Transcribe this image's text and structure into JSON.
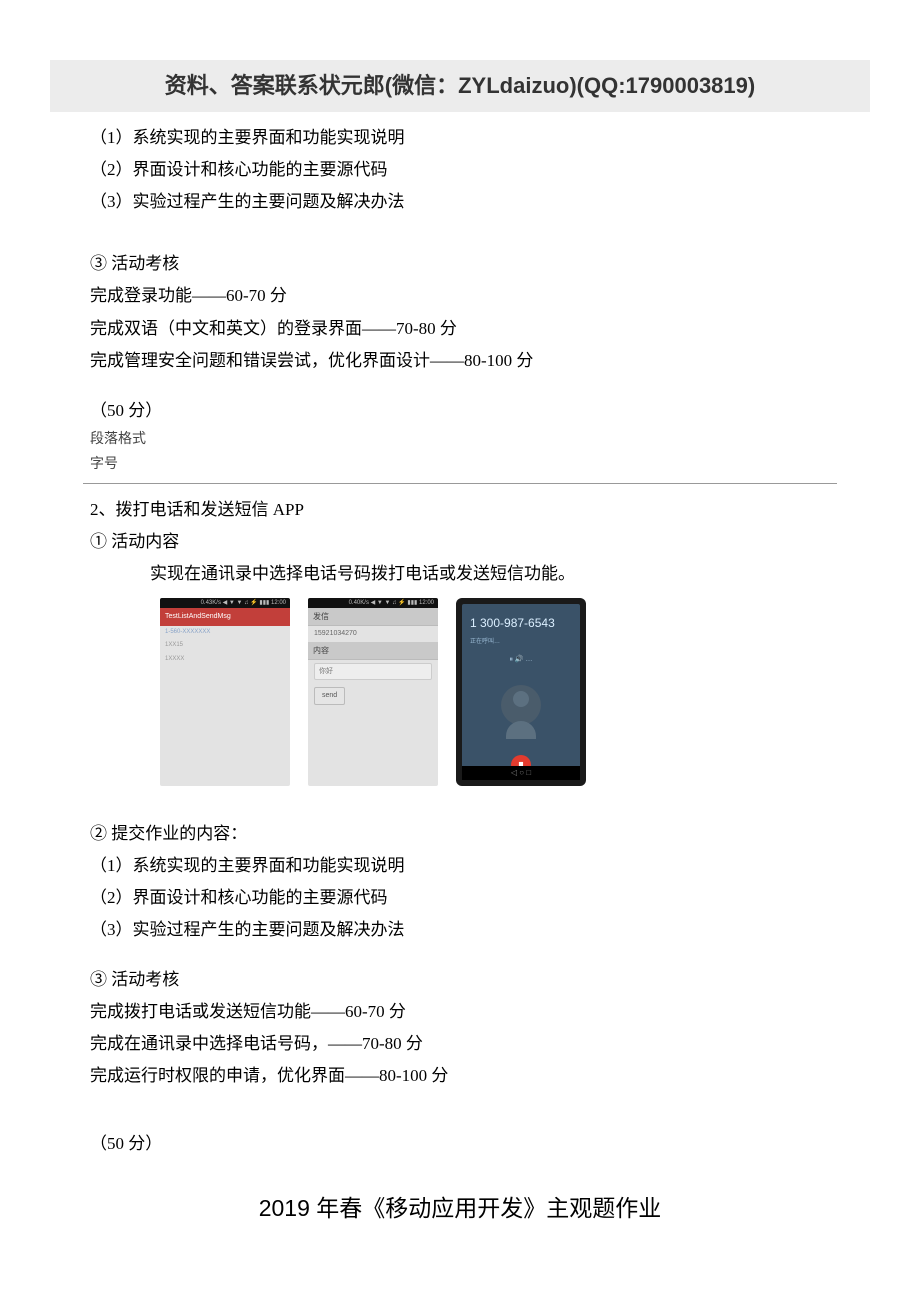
{
  "header": {
    "banner": "资料、答案联系状元郎(微信：ZYLdaizuo)(QQ:1790003819)"
  },
  "part1": {
    "sub1": "（1）系统实现的主要界面和功能实现说明",
    "sub2": "（2）界面设计和核心功能的主要源代码",
    "sub3": "（3）实验过程产生的主要问题及解决办法",
    "activity_heading": "③ 活动考核",
    "score_line1": "完成登录功能——60-70 分",
    "score_line2": "完成双语（中文和英文）的登录界面——70-80 分",
    "score_line3": "完成管理安全问题和错误尝试，优化界面设计——80-100 分",
    "points": "（50  分）",
    "meta1": "段落格式",
    "meta2": "字号"
  },
  "part2": {
    "title": "2、拨打电话和发送短信 APP",
    "activity1_heading": "① 活动内容",
    "activity1_desc": "实现在通讯录中选择电话号码拨打电话或发送短信功能。",
    "phoneshot1": {
      "status_time": "0.43K/s ◀ ▼ ▼ ♫ ⚡ ▮▮▮ 12:00",
      "app_title": "TestListAndSendMsg",
      "entry1": "1-560-XXXXXXX",
      "entry2": "1XX15",
      "entry3": "1XXXX"
    },
    "phoneshot2": {
      "status_time": "0.40K/s ◀ ▼ ▼ ♫ ⚡ ▮▮▮ 12:00",
      "label_phone": "发信",
      "value_phone": "15921034270",
      "label_content": "内容",
      "value_content": "你好",
      "send_button": "send"
    },
    "phoneshot3": {
      "number": "1 300-987-6543",
      "status": "正在呼叫…",
      "icons": "⏸  🔊  …",
      "hangup": "⏹",
      "nav": "◁  ○  □"
    },
    "activity2_heading": "② 提交作业的内容：",
    "sub1": "（1）系统实现的主要界面和功能实现说明",
    "sub2": "（2）界面设计和核心功能的主要源代码",
    "sub3": "（3）实验过程产生的主要问题及解决办法",
    "activity3_heading": "③ 活动考核",
    "score_line1": "完成拨打电话或发送短信功能——60-70 分",
    "score_line2": "完成在通讯录中选择电话号码，——70-80 分",
    "score_line3": "完成运行时权限的申请，优化界面——80-100 分",
    "points": "（50  分）"
  },
  "footer": {
    "bottom_title": "2019 年春《移动应用开发》主观题作业"
  }
}
